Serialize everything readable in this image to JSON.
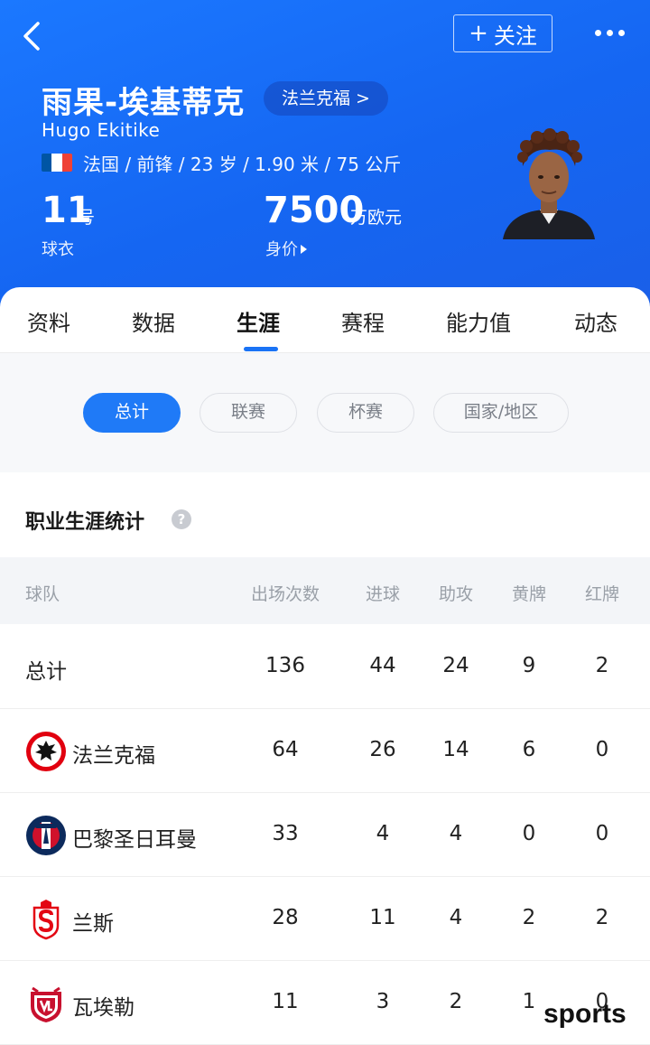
{
  "header": {
    "follow_label": "关注",
    "player_name": "雨果-埃基蒂克",
    "club_link": "法兰克福 >",
    "latin_name": "Hugo Ekitike",
    "bio": "法国 / 前锋 / 23 岁 / 1.90 米 / 75 公斤",
    "jersey_number": "11",
    "jersey_unit": "号",
    "jersey_label": "球衣",
    "market_value": "7500",
    "market_value_unit": "万欧元",
    "market_value_label": "身价",
    "flag_colors": [
      "#0055a4",
      "#ffffff",
      "#ef4135"
    ]
  },
  "tabs": [
    "资料",
    "数据",
    "生涯",
    "赛程",
    "能力值",
    "动态"
  ],
  "active_tab": "生涯",
  "filters": [
    "总计",
    "联赛",
    "杯赛",
    "国家/地区"
  ],
  "active_filter": "总计",
  "section": {
    "title": "职业生涯统计",
    "help_icon": "?"
  },
  "table": {
    "columns": [
      "球队",
      "出场次数",
      "进球",
      "助攻",
      "黄牌",
      "红牌"
    ],
    "rows": [
      {
        "team": "总计",
        "logo": null,
        "apps": "136",
        "goals": "44",
        "assists": "24",
        "yellow": "9",
        "red": "2"
      },
      {
        "team": "法兰克福",
        "logo": "frankfurt-eagle-logo",
        "apps": "64",
        "goals": "26",
        "assists": "14",
        "yellow": "6",
        "red": "0"
      },
      {
        "team": "巴黎圣日耳曼",
        "logo": "psg-logo",
        "apps": "33",
        "goals": "4",
        "assists": "4",
        "yellow": "0",
        "red": "0"
      },
      {
        "team": "兰斯",
        "logo": "reims-logo",
        "apps": "28",
        "goals": "11",
        "assists": "4",
        "yellow": "2",
        "red": "2"
      },
      {
        "team": "瓦埃勒",
        "logo": "vejle-logo",
        "apps": "11",
        "goals": "3",
        "assists": "2",
        "yellow": "1",
        "red": "0"
      }
    ]
  },
  "watermark": "sports",
  "colors": {
    "header_blue": "#1b6ff5",
    "accent_blue": "#1f7af7"
  }
}
